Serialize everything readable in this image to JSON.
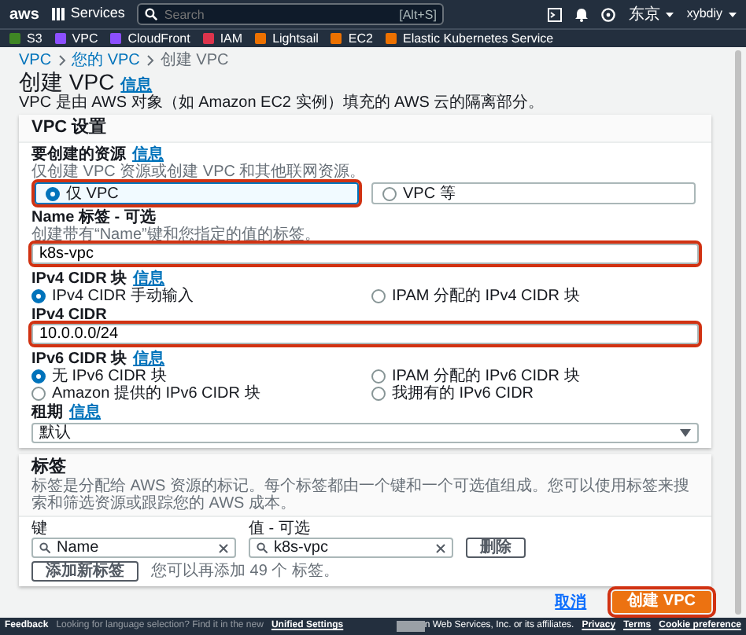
{
  "top_nav": {
    "logo": "aws",
    "services": "Services",
    "search": {
      "placeholder": "Search",
      "shortcut": "[Alt+S]"
    },
    "region": "东京",
    "user": "xybdiy"
  },
  "favorites": [
    {
      "label": "S3",
      "color": "#3f8624"
    },
    {
      "label": "VPC",
      "color": "#8c4fff"
    },
    {
      "label": "CloudFront",
      "color": "#8c4fff"
    },
    {
      "label": "IAM",
      "color": "#dd344c"
    },
    {
      "label": "Lightsail",
      "color": "#ed7100"
    },
    {
      "label": "EC2",
      "color": "#ed7100"
    },
    {
      "label": "Elastic Kubernetes Service",
      "color": "#ed7100"
    }
  ],
  "breadcrumb": [
    {
      "label": "VPC",
      "link": true
    },
    {
      "label": "您的 VPC",
      "link": true
    },
    {
      "label": "创建 VPC",
      "link": false
    }
  ],
  "page": {
    "title": "创建 VPC",
    "info": "信息",
    "description": "VPC 是由 AWS 对象（如 Amazon EC2 实例）填充的 AWS 云的隔离部分。"
  },
  "settings_card": {
    "title": "VPC 设置",
    "fields": [
      {
        "kind": "tiles",
        "label": "要创建的资源",
        "info": "信息",
        "hint": "仅创建 VPC 资源或创建 VPC 和其他联网资源。",
        "options": [
          {
            "label": "仅 VPC",
            "selected": true,
            "highlighted": true
          },
          {
            "label": "VPC 等",
            "selected": false,
            "highlighted": false
          }
        ]
      },
      {
        "kind": "text",
        "label": "Name 标签 - 可选",
        "hint": "创建带有“Name”键和您指定的值的标签。",
        "value": "k8s-vpc",
        "highlighted": true
      },
      {
        "kind": "radios",
        "label": "IPv4 CIDR 块",
        "info": "信息",
        "options": [
          {
            "label": "IPv4 CIDR 手动输入",
            "selected": true
          },
          {
            "label": "IPAM 分配的 IPv4 CIDR 块",
            "selected": false
          }
        ]
      },
      {
        "kind": "text",
        "label": "IPv4 CIDR",
        "value": "10.0.0.0/24",
        "highlighted": true
      },
      {
        "kind": "radios",
        "label": "IPv6 CIDR 块",
        "info": "信息",
        "options": [
          {
            "label": "无 IPv6 CIDR 块",
            "selected": true
          },
          {
            "label": "IPAM 分配的 IPv6 CIDR 块",
            "selected": false
          },
          {
            "label": "Amazon 提供的 IPv6 CIDR 块",
            "selected": false
          },
          {
            "label": "我拥有的 IPv6 CIDR",
            "selected": false
          }
        ]
      },
      {
        "kind": "select",
        "label": "租期",
        "info": "信息",
        "value": "默认"
      }
    ]
  },
  "tags_card": {
    "title": "标签",
    "description": "标签是分配给 AWS 资源的标记。每个标签都由一个键和一个可选值组成。您可以使用标签来搜索和筛选资源或跟踪您的 AWS 成本。",
    "key_label": "键",
    "value_label": "值 - 可选",
    "tags": [
      {
        "key": "Name",
        "value": "k8s-vpc",
        "remove": "删除"
      }
    ],
    "add_button": "添加新标签",
    "note": "您可以再添加 49 个 标签。"
  },
  "actions": {
    "cancel": "取消",
    "create": "创建 VPC",
    "create_highlighted": true
  },
  "footer": {
    "feedback": "Feedback",
    "notice": "Looking for language selection? Find it in the new",
    "notice_link": "Unified Settings",
    "copyright": "n Web Services, Inc. or its affiliates.",
    "links": [
      "Privacy",
      "Terms",
      "Cookie preference"
    ]
  }
}
